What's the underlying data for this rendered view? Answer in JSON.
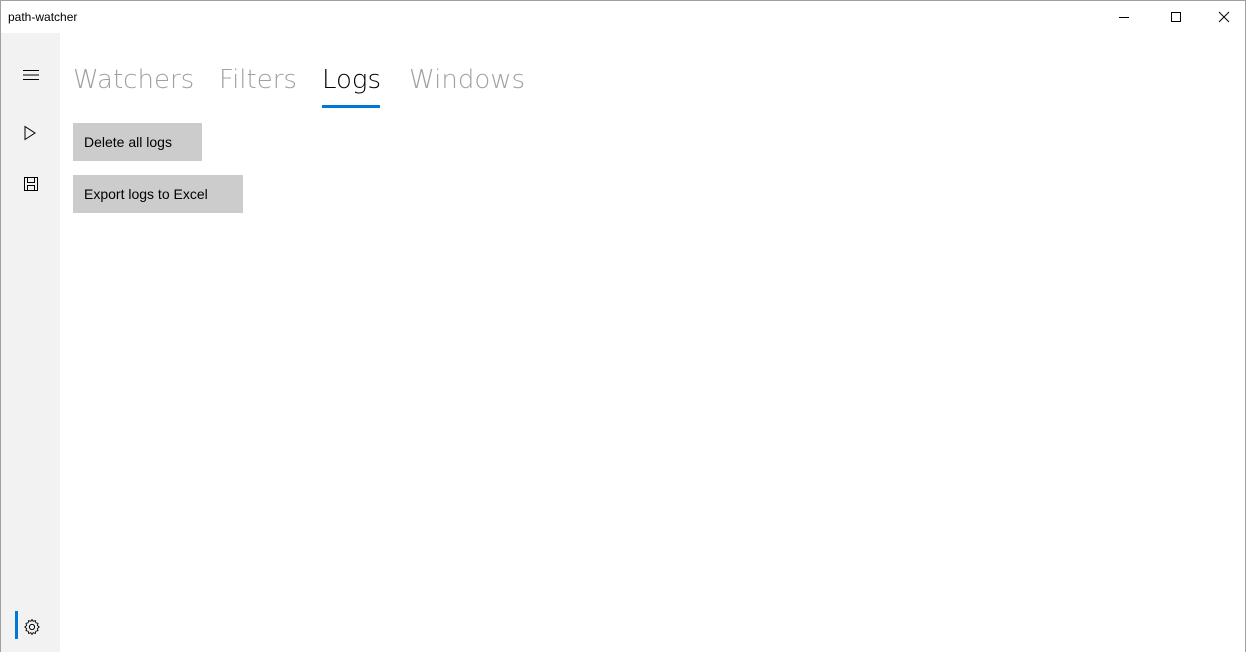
{
  "window": {
    "title": "path-watcher",
    "caption_buttons": {
      "minimize": "–",
      "maximize": "☐",
      "close": "✕"
    }
  },
  "nav": {
    "items": [
      {
        "name": "menu",
        "icon": "hamburger-icon"
      },
      {
        "name": "run",
        "icon": "play-icon"
      },
      {
        "name": "save",
        "icon": "save-icon"
      },
      {
        "name": "settings",
        "icon": "gear-icon",
        "selected": true
      }
    ],
    "accent": "#0078d7"
  },
  "tabs": [
    {
      "label": "Watchers",
      "selected": false
    },
    {
      "label": "Filters",
      "selected": false
    },
    {
      "label": "Logs",
      "selected": true
    },
    {
      "label": "Windows",
      "selected": false
    }
  ],
  "actions": {
    "delete_label": "Delete all logs",
    "export_label": "Export logs to Excel"
  }
}
